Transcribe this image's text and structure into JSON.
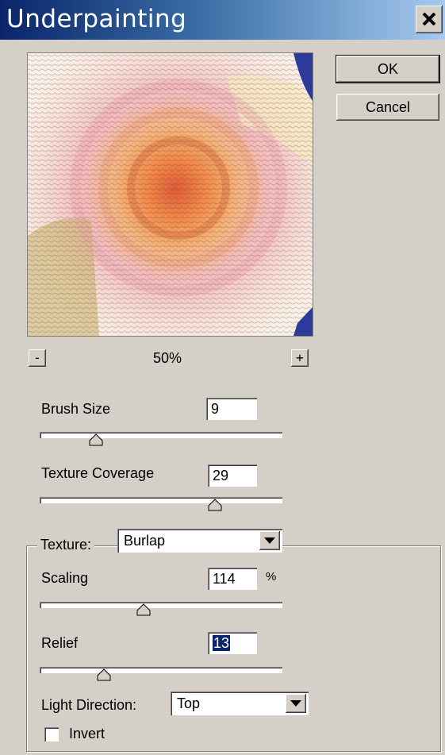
{
  "window": {
    "title": "Underpainting"
  },
  "buttons": {
    "ok": "OK",
    "cancel": "Cancel"
  },
  "preview": {
    "zoom_minus": "-",
    "zoom_plus": "+",
    "zoom_level": "50%"
  },
  "brush_size": {
    "label": "Brush Size",
    "value": "9",
    "slider_fraction": 0.23
  },
  "texture_coverage": {
    "label": "Texture Coverage",
    "value": "29",
    "slider_fraction": 0.72
  },
  "texture": {
    "label": "Texture:",
    "selected": "Burlap"
  },
  "scaling": {
    "label": "Scaling",
    "value": "114",
    "unit": "%",
    "slider_fraction": 0.42
  },
  "relief": {
    "label": "Relief",
    "value": "13",
    "slider_fraction": 0.26
  },
  "light_direction": {
    "label": "Light Direction:",
    "selected": "Top"
  },
  "invert": {
    "label": "Invert",
    "checked": false
  },
  "icons": {
    "close": "close-icon",
    "dropdown": "chevron-down-icon",
    "thumb": "slider-thumb-icon"
  }
}
